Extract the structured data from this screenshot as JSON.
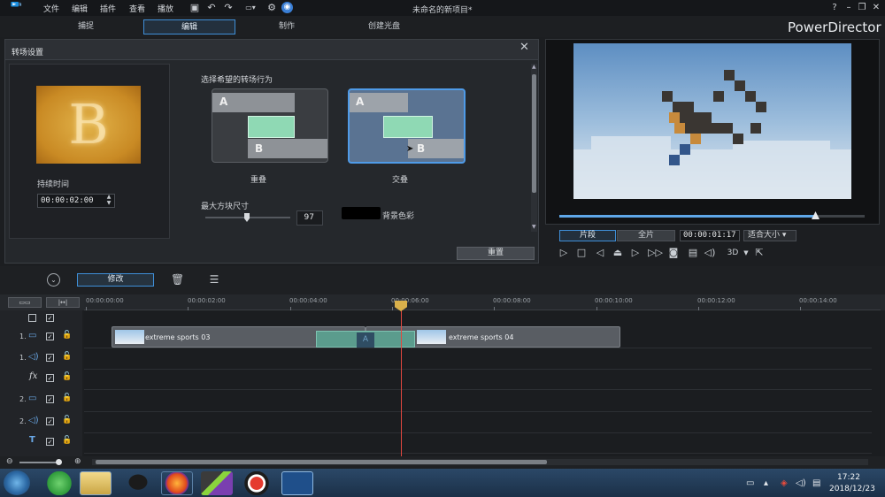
{
  "menu": {
    "file": "文件",
    "edit": "编辑",
    "plugins": "插件",
    "view": "查看",
    "playback": "播放"
  },
  "doc_title": "未命名的新项目*",
  "brand": "PowerDirector",
  "modes": {
    "capture": "捕捉",
    "edit": "编辑",
    "produce": "制作",
    "disc": "创建光盘"
  },
  "transition_panel": {
    "title": "转场设置",
    "preview_letter": "B",
    "duration_label": "持续时间",
    "duration_value": "00:00:02:00",
    "behavior_label": "选择希望的转场行为",
    "option_overlap": {
      "label": "重叠",
      "a": "A",
      "b": "B"
    },
    "option_cross": {
      "label": "交叠",
      "a": "A",
      "b": "B"
    },
    "max_size_label": "最大方块尺寸",
    "max_size_value": "97",
    "bg_color_label": "背景色彩",
    "bg_color": "#000000",
    "reset_label": "重置"
  },
  "preview": {
    "segment_clip": "片段",
    "segment_full": "全片",
    "timecode": "00:00:01:17",
    "fit": "适合大小",
    "mode3d": "3D",
    "progress": 0.84
  },
  "toolbar": {
    "modify_label": "修改"
  },
  "timeline": {
    "ruler": [
      "00:00:00:00",
      "00:00:02:00",
      "00:00:04:00",
      "00:00:06:00",
      "00:00:08:00",
      "00:00:10:00",
      "00:00:12:00",
      "00:00:14:00"
    ],
    "tracks": [
      {
        "num": "1.",
        "icon": "video-icon"
      },
      {
        "num": "1.",
        "icon": "audio-icon"
      },
      {
        "num": "",
        "icon": "fx-icon"
      },
      {
        "num": "2.",
        "icon": "video-icon"
      },
      {
        "num": "2.",
        "icon": "audio-icon"
      },
      {
        "num": "",
        "icon": "title-icon"
      }
    ],
    "clip1_name": "extreme sports 03",
    "clip2_name": "extreme sports 04",
    "transition_mark": "A"
  },
  "taskbar": {
    "time": "17:22",
    "date": "2018/12/23"
  },
  "colors": {
    "accent": "#3f8fd8",
    "panel": "#25282c",
    "transition": "#5b9c8d",
    "playhead": "#e2473f"
  }
}
